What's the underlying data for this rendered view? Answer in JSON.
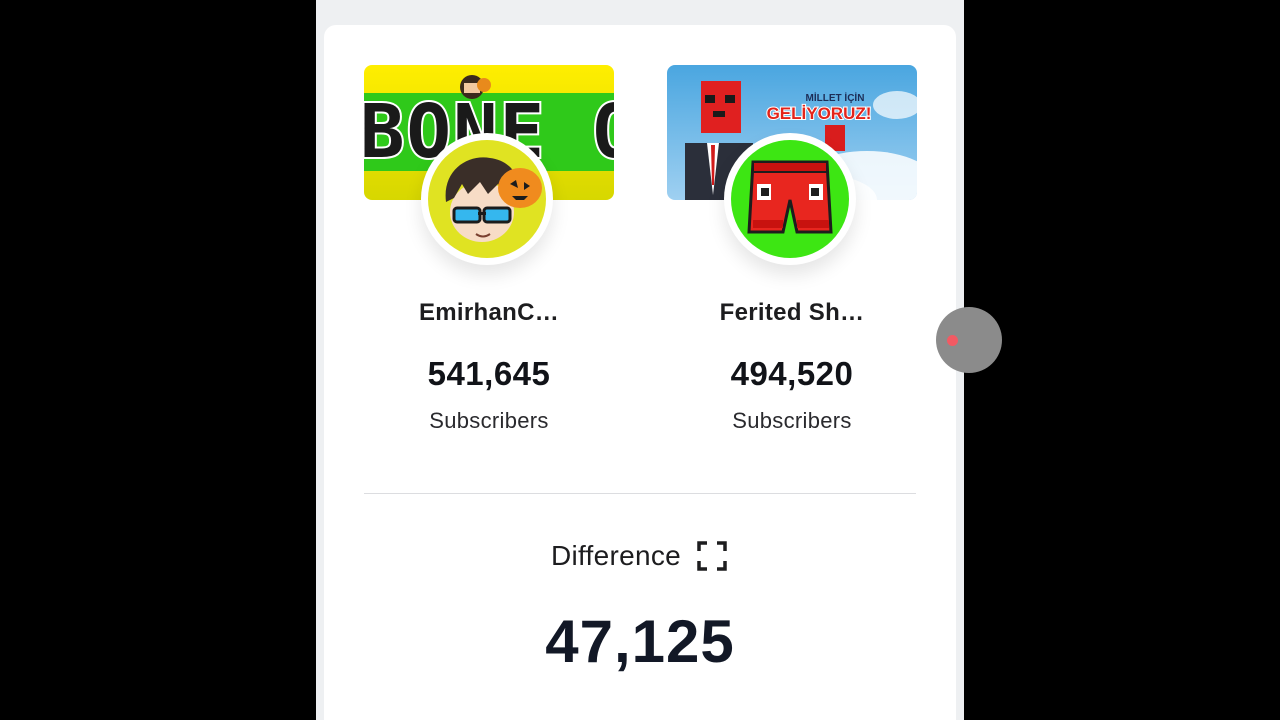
{
  "channels": [
    {
      "name": "EmirhanC…",
      "subscribers": "541,645",
      "subscribers_label": "Subscribers",
      "banner_text": "BONE O",
      "banner_icon": "banner-image",
      "avatar_icon": "avatar-image",
      "colors": {
        "banner_top": "#ffe900",
        "banner_bottom": "#cccc00",
        "banner_mid": "#2fc91a",
        "avatar_bg": "#e0e322"
      }
    },
    {
      "name": "Ferited Sh…",
      "subscribers": "494,520",
      "subscribers_label": "Subscribers",
      "banner_text_1": "MİLLET İÇİN",
      "banner_text_2": "GELİYORUZ!",
      "banner_icon": "banner-image",
      "avatar_icon": "avatar-image",
      "colors": {
        "banner_sky": "#5fb1e6",
        "avatar_bg": "#3de613",
        "shorts": "#e8261f"
      }
    }
  ],
  "difference": {
    "label": "Difference",
    "value": "47,125",
    "expand_icon": "fullscreen-icon"
  },
  "edge_handle": {
    "icon": "record-dot-icon",
    "dot_color": "#f25a63"
  }
}
